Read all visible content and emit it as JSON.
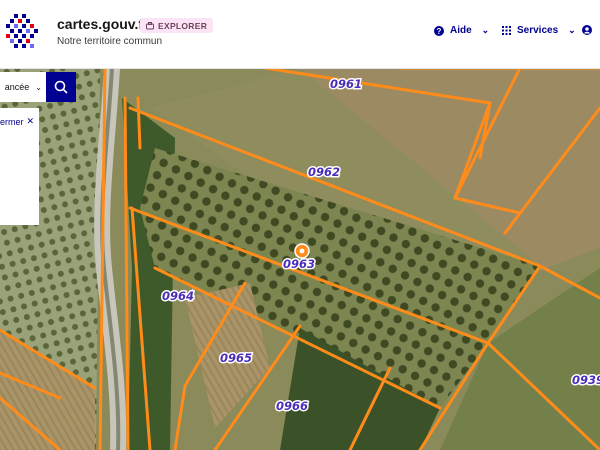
{
  "header": {
    "brand": "cartes.gouv.fr",
    "badge": "EXPLORER",
    "tagline": "Notre territoire commun",
    "nav": [
      {
        "label": "Aide",
        "icon": "help-icon"
      },
      {
        "label": "Services",
        "icon": "grid-icon"
      },
      {
        "label": "",
        "icon": "account-icon"
      }
    ]
  },
  "search": {
    "selector_label": "ancée",
    "button_icon": "search-icon"
  },
  "panel": {
    "close_label": "ermer"
  },
  "map": {
    "parcels": [
      {
        "id": "0961"
      },
      {
        "id": "0962"
      },
      {
        "id": "0963"
      },
      {
        "id": "0964"
      },
      {
        "id": "0965"
      },
      {
        "id": "0966"
      },
      {
        "id": "0939"
      }
    ],
    "marker_icon": "location-marker-icon",
    "colors": {
      "parcel_line": "#ff8c1a",
      "label": "#4a2db8",
      "marker": "#ff8c1a"
    }
  }
}
